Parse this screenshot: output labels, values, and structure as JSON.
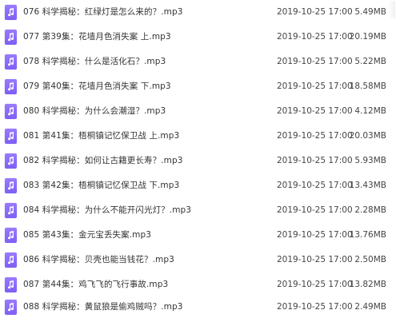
{
  "files": [
    {
      "name": "076 科学揭秘：红绿灯是怎么来的？.mp3",
      "date": "2019-10-25 17:00",
      "size": "5.49MB"
    },
    {
      "name": "077 第39集：花墙月色消失案 上.mp3",
      "date": "2019-10-25 17:00",
      "size": "20.19MB"
    },
    {
      "name": "078 科学揭秘：什么是活化石？.mp3",
      "date": "2019-10-25 17:00",
      "size": "5.22MB"
    },
    {
      "name": "079 第40集：花墙月色消失案 下.mp3",
      "date": "2019-10-25 17:00",
      "size": "18.58MB"
    },
    {
      "name": "080 科学揭秘：为什么会潮湿？.mp3",
      "date": "2019-10-25 17:00",
      "size": "4.12MB"
    },
    {
      "name": "081 第41集：梧桐镇记忆保卫战 上.mp3",
      "date": "2019-10-25 17:00",
      "size": "20.03MB"
    },
    {
      "name": "082 科学揭秘：如何让古籍更长寿？.mp3",
      "date": "2019-10-25 17:00",
      "size": "5.93MB"
    },
    {
      "name": "083 第42集：梧桐镇记忆保卫战 下.mp3",
      "date": "2019-10-25 17:00",
      "size": "13.43MB"
    },
    {
      "name": "084 科学揭秘：为什么不能开闪光灯？.mp3",
      "date": "2019-10-25 17:00",
      "size": "2.28MB"
    },
    {
      "name": "085 第43集：金元宝丢失案.mp3",
      "date": "2019-10-25 17:00",
      "size": "13.76MB"
    },
    {
      "name": "086 科学揭秘：贝壳也能当钱花？.mp3",
      "date": "2019-10-25 17:00",
      "size": "2.50MB"
    },
    {
      "name": "087 第44集：鸡飞飞的飞行事故.mp3",
      "date": "2019-10-25 17:00",
      "size": "13.82MB"
    },
    {
      "name": "088 科学揭秘：黄鼠狼是偷鸡贼吗？.mp3",
      "date": "2019-10-25 17:00",
      "size": "2.49MB"
    }
  ],
  "icon": "audio-file-icon",
  "colors": {
    "icon_bg": "#8a6cf8",
    "text": "#333333"
  }
}
